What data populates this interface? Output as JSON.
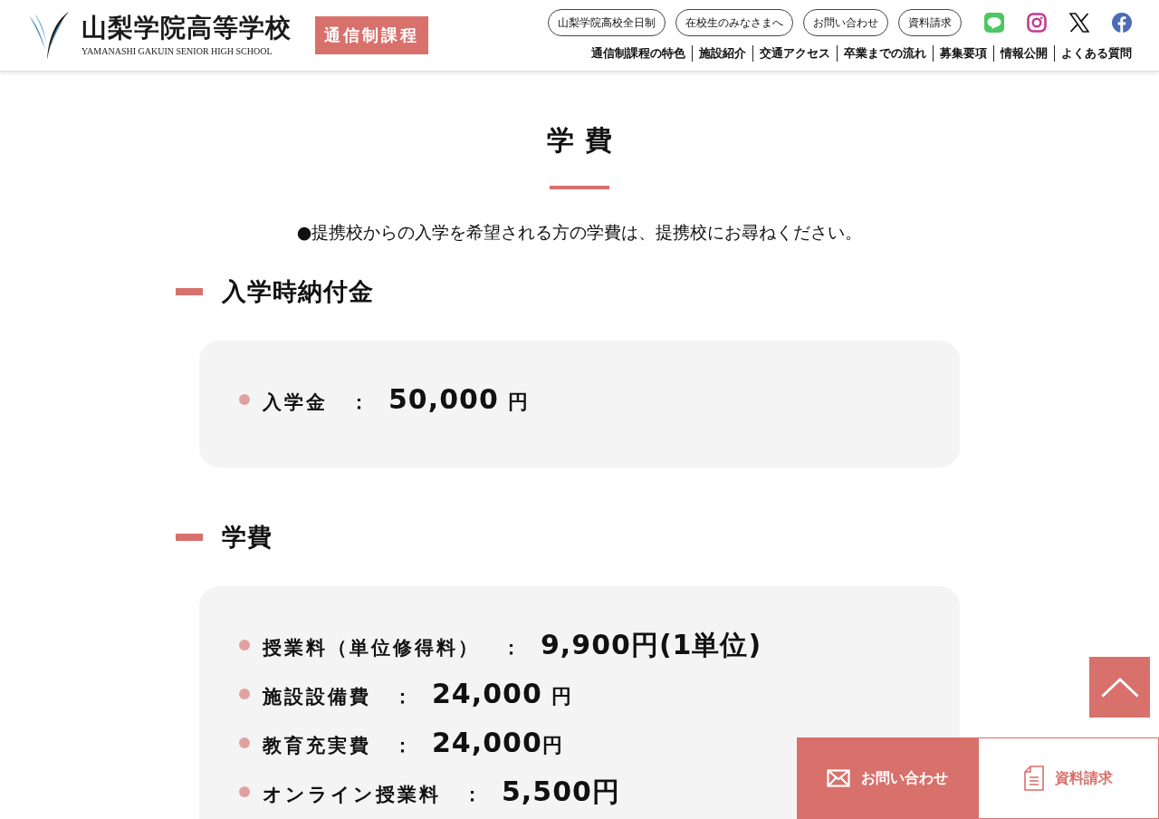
{
  "header": {
    "logo": {
      "name": "山梨学院高等学校",
      "subtitle": "YAMANASHI GAKUIN SENIOR HIGH SCHOOL"
    },
    "badge": "通信制課程",
    "top_links": [
      "山梨学院高校全日制",
      "在校生のみなさまへ",
      "お問い合わせ",
      "資料請求"
    ],
    "nav": [
      "通信制課程の特色",
      "施設紹介",
      "交通アクセス",
      "卒業までの流れ",
      "募集要項",
      "情報公開",
      "よくある質問"
    ]
  },
  "page_title": "学費",
  "notice": "●提携校からの入学を希望される方の学費は、提携校にお尋ねください。",
  "sections": [
    {
      "heading": "入学時納付金",
      "items": [
        {
          "label": "入学金",
          "separator": "：",
          "amount": "50,000",
          "unit": "円",
          "unit_spaced": true
        }
      ]
    },
    {
      "heading": "学費",
      "items": [
        {
          "label": "授業料（単位修得料）",
          "separator": "：",
          "amount": "9,900円(1単位)"
        },
        {
          "label": "施設設備費",
          "separator": "：",
          "amount": "24,000",
          "unit": "円",
          "unit_spaced": true
        },
        {
          "label": "教育充実費",
          "separator": "：",
          "amount": "24,000",
          "unit": "円",
          "unit_spaced": false
        },
        {
          "label": "オンライン授業料",
          "separator": "：",
          "amount": "5,500円"
        }
      ]
    }
  ],
  "footer_buttons": [
    {
      "kind": "contact",
      "label": "お問い合わせ"
    },
    {
      "kind": "request",
      "label": "資料請求"
    }
  ]
}
